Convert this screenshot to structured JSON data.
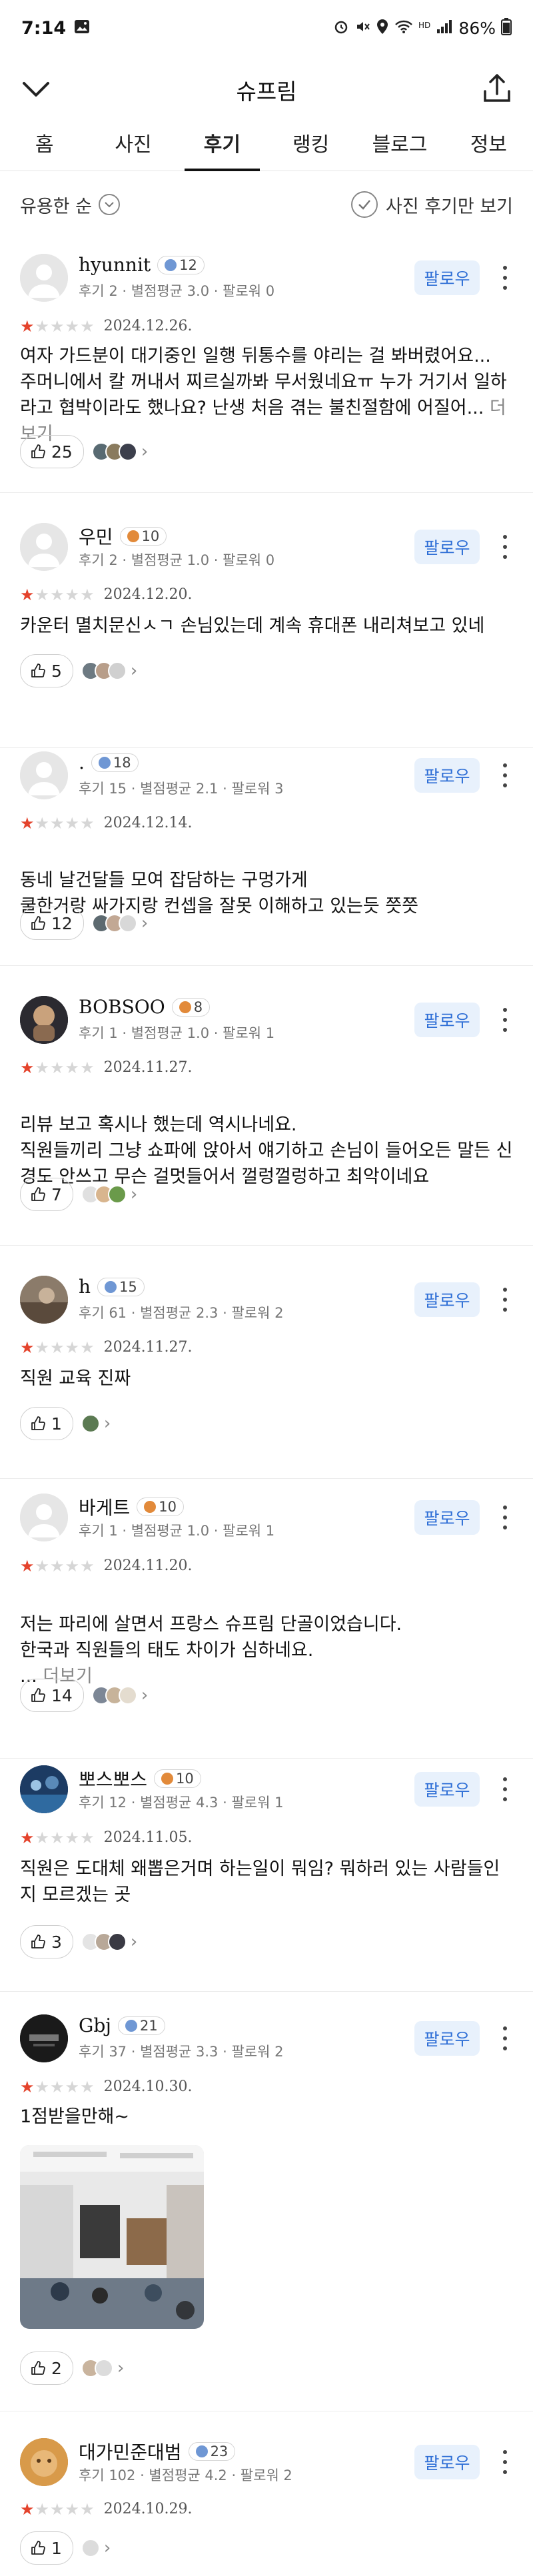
{
  "status": {
    "time": "7:14",
    "battery": "86%"
  },
  "header": {
    "title": "슈프림"
  },
  "tabs": [
    "홈",
    "사진",
    "후기",
    "랭킹",
    "블로그",
    "정보"
  ],
  "filter": {
    "sort_label": "유용한 순",
    "photo_only_label": "사진 후기만 보기"
  },
  "ui": {
    "follow_label": "팔로우",
    "more_label": "더보기"
  },
  "reviews": [
    {
      "nick": "hyunnit",
      "level": "12",
      "stats": "후기 2 · 별점평균 3.0 · 팔로워 0",
      "rating": 1,
      "date": "2024.12.26.",
      "text": "여자 가드분이 대기중인 일행 뒤통수를 야리는 걸 봐버렸어요... 주머니에서 칼 꺼내서 찌르실까봐 무서웠네요ㅠ 누가 거기서 일하라고 협박이라도 했나요? 난생 처음 겪는 불친절함에 어질어...",
      "has_more": true,
      "likes": "25"
    },
    {
      "nick": "우민",
      "level": "10",
      "stats": "후기 2 · 별점평균 1.0 · 팔로워 0",
      "rating": 1,
      "date": "2024.12.20.",
      "text": "카운터 멸치문신ㅅㄱ 손님있는데 계속 휴대폰 내리쳐보고 있네",
      "has_more": false,
      "likes": "5"
    },
    {
      "nick": ".",
      "level": "18",
      "stats": "후기 15 · 별점평균 2.1 · 팔로워 3",
      "rating": 1,
      "date": "2024.12.14.",
      "text": "동네 날건달들 모여 잡담하는 구멍가게\n쿨한거랑 싸가지랑 컨셉을 잘못 이해하고 있는듯  쯧쯧",
      "has_more": false,
      "likes": "12"
    },
    {
      "nick": "BOBSOO",
      "level": "8",
      "stats": "후기 1 · 별점평균 1.0 · 팔로워 1",
      "rating": 1,
      "date": "2024.11.27.",
      "text": "리뷰 보고 혹시나 했는데 역시나네요.\n직원들끼리 그냥 쇼파에 앉아서 얘기하고 손님이 들어오든 말든 신경도 안쓰고 무슨 걸멋들어서 껄렁껄렁하고 최악이네요",
      "has_more": false,
      "likes": "7"
    },
    {
      "nick": "h",
      "level": "15",
      "stats": "후기 61 · 별점평균 2.3 · 팔로워 2",
      "rating": 1,
      "date": "2024.11.27.",
      "text": "직원 교육 진짜",
      "has_more": false,
      "likes": "1"
    },
    {
      "nick": "바게트",
      "level": "10",
      "stats": "후기 1 · 별점평균 1.0 · 팔로워 1",
      "rating": 1,
      "date": "2024.11.20.",
      "text": "저는 파리에 살면서 프랑스 슈프림 단골이었습니다.\n한국과 직원들의 태도 차이가 심하네요.\n...",
      "has_more": true,
      "likes": "14"
    },
    {
      "nick": "뽀스뽀스",
      "level": "10",
      "stats": "후기 12 · 별점평균 4.3 · 팔로워 1",
      "rating": 1,
      "date": "2024.11.05.",
      "text": "직원은 도대체 왜뽑은거며 하는일이 뭐임? 뭐하러 있는 사람들인지 모르겠는 곳",
      "has_more": false,
      "likes": "3"
    },
    {
      "nick": "Gbj",
      "level": "21",
      "stats": "후기 37 · 별점평균 3.3 · 팔로워 2",
      "rating": 1,
      "date": "2024.10.30.",
      "text": "1점받을만해~",
      "has_more": false,
      "likes": "2"
    },
    {
      "nick": "대가민준대범",
      "level": "23",
      "stats": "후기 102 · 별점평균 4.2 · 팔로워 2",
      "rating": 1,
      "date": "2024.10.29.",
      "text": "",
      "has_more": false,
      "likes": "1"
    }
  ],
  "colors": {
    "star_on": "#e4432c",
    "follow_bg": "#e8f1fc",
    "follow_text": "#2f6fd6"
  }
}
